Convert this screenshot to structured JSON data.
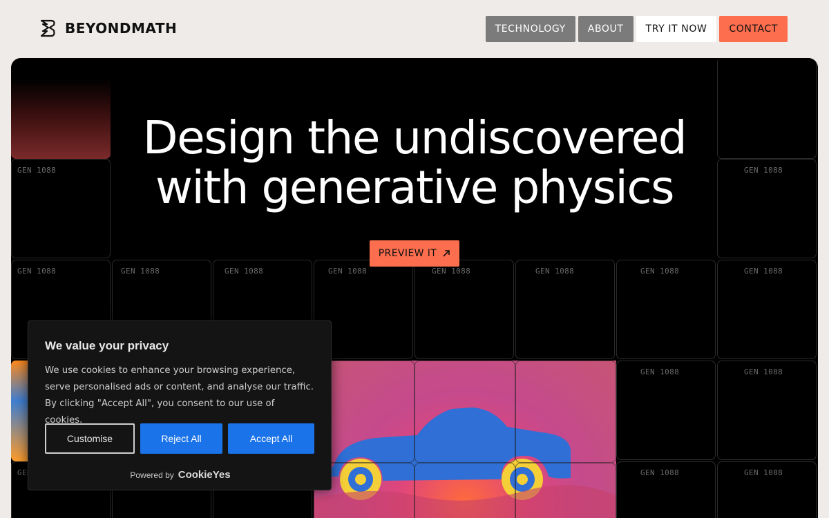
{
  "header": {
    "logo_text": "BEYONDMATH",
    "nav": [
      {
        "label": "TECHNOLOGY",
        "style": "gray"
      },
      {
        "label": "ABOUT",
        "style": "gray"
      },
      {
        "label": "TRY IT NOW",
        "style": "white"
      },
      {
        "label": "CONTACT",
        "style": "orange"
      }
    ]
  },
  "hero": {
    "headline_line1": "Design the undiscovered",
    "headline_line2": "with generative physics",
    "cta_label": "PREVIEW IT",
    "tile_label": "GEN 1088"
  },
  "cookie_banner": {
    "title": "We value your privacy",
    "text": "We use cookies to enhance your browsing experience, serve personalised ads or content, and analyse our traffic. By clicking \"Accept All\", you consent to our use of cookies.",
    "customise_label": "Customise",
    "reject_label": "Reject All",
    "accept_label": "Accept All",
    "powered_by": "Powered by",
    "powered_brand": "CookieYes"
  },
  "colors": {
    "accent_orange": "#fd6e4f",
    "nav_gray": "#7b7b7b",
    "cookie_blue": "#1a73e8",
    "page_bg": "#efebe8"
  }
}
